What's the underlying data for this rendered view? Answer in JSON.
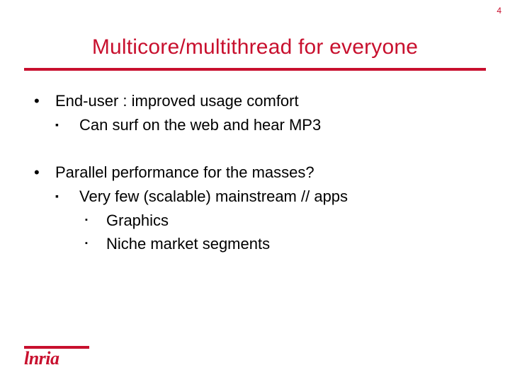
{
  "pageNumber": "4",
  "title": "Multicore/multithread  for everyone",
  "bullets": {
    "b1": {
      "text": "End-user :  improved usage comfort",
      "sub": {
        "s1": "Can surf on the web and  hear MP3"
      }
    },
    "b2": {
      "text": "Parallel  performance   for the masses?",
      "sub": {
        "s1": "Very few (scalable) mainstream // apps",
        "sub2": {
          "a": "Graphics",
          "b": "Niche market segments"
        }
      }
    }
  },
  "logo": "lnria"
}
